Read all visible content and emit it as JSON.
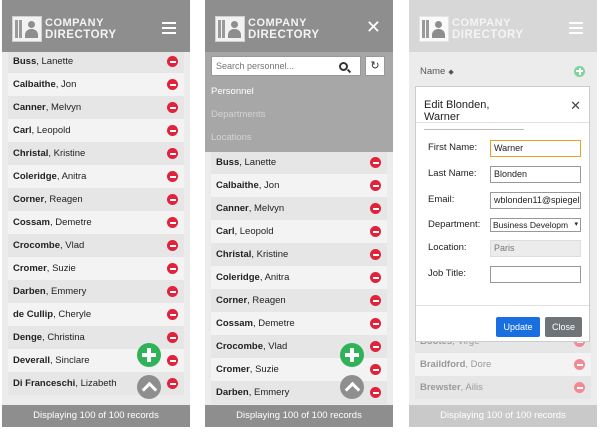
{
  "app": {
    "logo_line1": "COMPANY",
    "logo_line2": "DIRECTORY"
  },
  "footer_text": "Displaying 100 of 100 records",
  "panel1": {
    "rows": [
      {
        "last": "Buss",
        "first": ", Lanette"
      },
      {
        "last": "Calbaithe",
        "first": ", Jon"
      },
      {
        "last": "Canner",
        "first": ", Melvyn"
      },
      {
        "last": "Carl",
        "first": ", Leopold"
      },
      {
        "last": "Christal",
        "first": ", Kristine"
      },
      {
        "last": "Coleridge",
        "first": ", Anitra"
      },
      {
        "last": "Corner",
        "first": ", Reagen"
      },
      {
        "last": "Cossam",
        "first": ", Demetre"
      },
      {
        "last": "Crocombe",
        "first": ", Vlad"
      },
      {
        "last": "Cromer",
        "first": ", Suzie"
      },
      {
        "last": "Darben",
        "first": ", Emmery"
      },
      {
        "last": "de Cullip",
        "first": ", Cheryle"
      },
      {
        "last": "Denge",
        "first": ", Christina"
      },
      {
        "last": "Deverall",
        "first": ", Sinclare"
      },
      {
        "last": "Di Franceschi",
        "first": ", Lizabeth"
      }
    ]
  },
  "panel2": {
    "search_placeholder": "Search personnel...",
    "menu": [
      "Personnel",
      "Departments",
      "Locations"
    ],
    "rows": [
      {
        "last": "Buss",
        "first": ", Lanette"
      },
      {
        "last": "Calbaithe",
        "first": ", Jon"
      },
      {
        "last": "Canner",
        "first": ", Melvyn"
      },
      {
        "last": "Carl",
        "first": ", Leopold"
      },
      {
        "last": "Christal",
        "first": ", Kristine"
      },
      {
        "last": "Coleridge",
        "first": ", Anitra"
      },
      {
        "last": "Corner",
        "first": ", Reagen"
      },
      {
        "last": "Cossam",
        "first": ", Demetre"
      },
      {
        "last": "Crocombe",
        "first": ", Vlad"
      },
      {
        "last": "Cromer",
        "first": ", Suzie"
      },
      {
        "last": "Darben",
        "first": ", Emmery"
      }
    ]
  },
  "panel3": {
    "column_header": "Name",
    "modal": {
      "title": "Edit Blonden, Warner",
      "first_name_label": "First Name:",
      "first_name_value": "Warner",
      "last_name_label": "Last Name:",
      "last_name_value": "Blonden",
      "email_label": "Email:",
      "email_value": "wblonden11@spiegel",
      "department_label": "Department:",
      "department_value": "Business Developm",
      "location_label": "Location:",
      "location_value": "Paris",
      "job_title_label": "Job Title:",
      "job_title_value": "",
      "update_label": "Update",
      "close_label": "Close"
    },
    "rows": [
      {
        "last": "Bootes",
        "first": ", Virge"
      },
      {
        "last": "Braildford",
        "first": ", Dore"
      },
      {
        "last": "Brewster",
        "first": ", Ailis"
      }
    ]
  }
}
